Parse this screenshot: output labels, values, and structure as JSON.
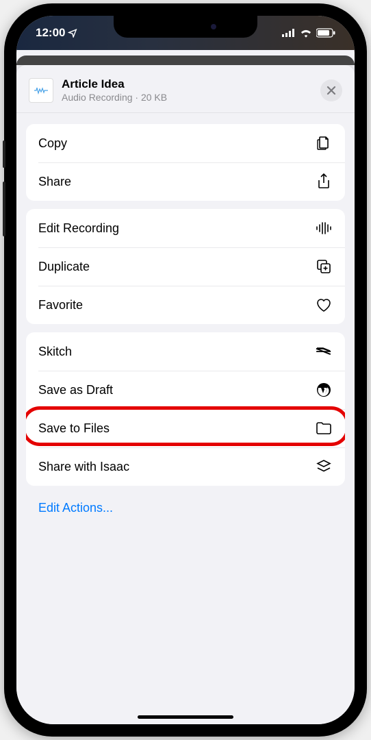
{
  "status": {
    "time": "12:00"
  },
  "header": {
    "title": "Article Idea",
    "subtitle_type": "Audio Recording",
    "subtitle_sep": " · ",
    "subtitle_size": "20 KB"
  },
  "groups": [
    {
      "items": [
        {
          "id": "copy",
          "label": "Copy",
          "icon": "copy"
        },
        {
          "id": "share",
          "label": "Share",
          "icon": "share"
        }
      ]
    },
    {
      "items": [
        {
          "id": "edit-recording",
          "label": "Edit Recording",
          "icon": "waveform"
        },
        {
          "id": "duplicate",
          "label": "Duplicate",
          "icon": "duplicate"
        },
        {
          "id": "favorite",
          "label": "Favorite",
          "icon": "heart"
        }
      ]
    },
    {
      "items": [
        {
          "id": "skitch",
          "label": "Skitch",
          "icon": "skitch"
        },
        {
          "id": "save-as-draft",
          "label": "Save as Draft",
          "icon": "wordpress"
        },
        {
          "id": "save-to-files",
          "label": "Save to Files",
          "icon": "folder",
          "highlighted": true
        },
        {
          "id": "share-with-isaac",
          "label": "Share with Isaac",
          "icon": "stack"
        }
      ]
    }
  ],
  "footer": {
    "edit_actions": "Edit Actions..."
  }
}
